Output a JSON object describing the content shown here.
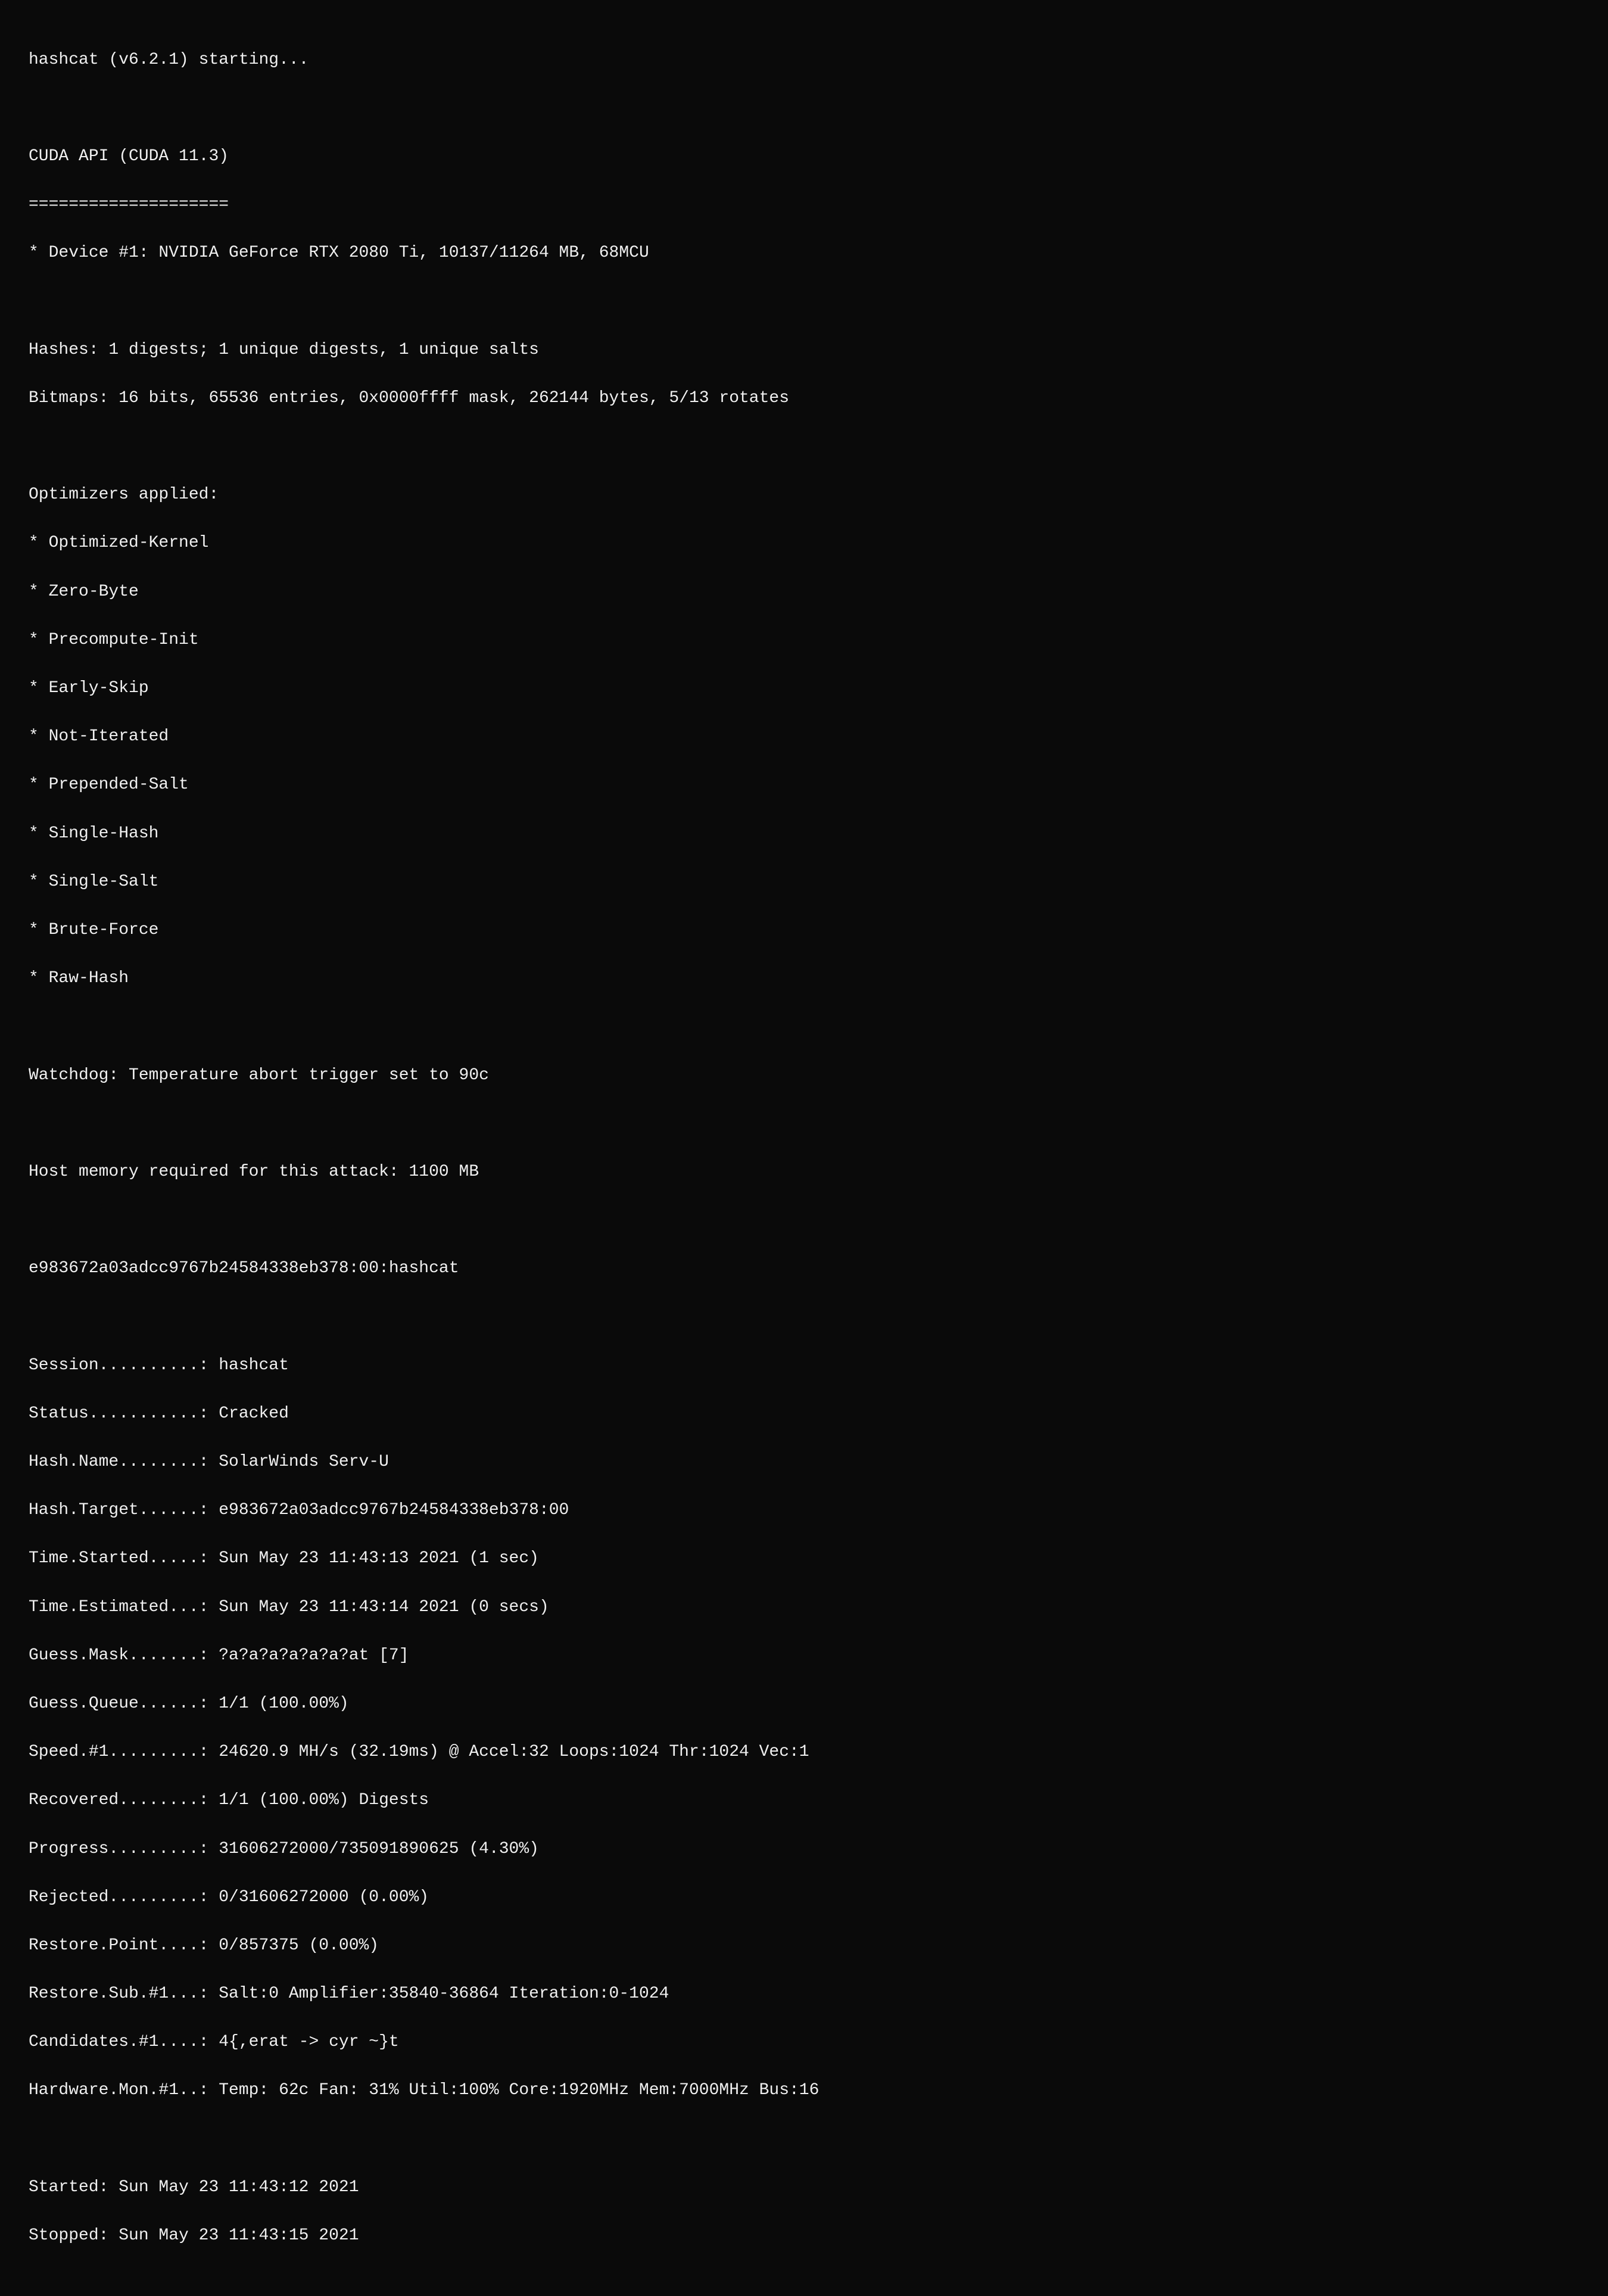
{
  "terminal": {
    "lines": [
      {
        "id": "line-1",
        "text": "hashcat (v6.2.1) starting..."
      },
      {
        "id": "blank-1",
        "text": ""
      },
      {
        "id": "line-2",
        "text": "CUDA API (CUDA 11.3)"
      },
      {
        "id": "line-3",
        "text": "===================="
      },
      {
        "id": "line-4",
        "text": "* Device #1: NVIDIA GeForce RTX 2080 Ti, 10137/11264 MB, 68MCU"
      },
      {
        "id": "blank-2",
        "text": ""
      },
      {
        "id": "line-5",
        "text": "Hashes: 1 digests; 1 unique digests, 1 unique salts"
      },
      {
        "id": "line-6",
        "text": "Bitmaps: 16 bits, 65536 entries, 0x0000ffff mask, 262144 bytes, 5/13 rotates"
      },
      {
        "id": "blank-3",
        "text": ""
      },
      {
        "id": "line-7",
        "text": "Optimizers applied:"
      },
      {
        "id": "line-8",
        "text": "* Optimized-Kernel"
      },
      {
        "id": "line-9",
        "text": "* Zero-Byte"
      },
      {
        "id": "line-10",
        "text": "* Precompute-Init"
      },
      {
        "id": "line-11",
        "text": "* Early-Skip"
      },
      {
        "id": "line-12",
        "text": "* Not-Iterated"
      },
      {
        "id": "line-13",
        "text": "* Prepended-Salt"
      },
      {
        "id": "line-14",
        "text": "* Single-Hash"
      },
      {
        "id": "line-15",
        "text": "* Single-Salt"
      },
      {
        "id": "line-16",
        "text": "* Brute-Force"
      },
      {
        "id": "line-17",
        "text": "* Raw-Hash"
      },
      {
        "id": "blank-4",
        "text": ""
      },
      {
        "id": "line-18",
        "text": "Watchdog: Temperature abort trigger set to 90c"
      },
      {
        "id": "blank-5",
        "text": ""
      },
      {
        "id": "line-19",
        "text": "Host memory required for this attack: 1100 MB"
      },
      {
        "id": "blank-6",
        "text": ""
      },
      {
        "id": "line-20",
        "text": "e983672a03adcc9767b24584338eb378:00:hashcat"
      },
      {
        "id": "blank-7",
        "text": ""
      },
      {
        "id": "line-21",
        "text": "Session..........: hashcat"
      },
      {
        "id": "line-22",
        "text": "Status...........: Cracked"
      },
      {
        "id": "line-23",
        "text": "Hash.Name........: SolarWinds Serv-U"
      },
      {
        "id": "line-24",
        "text": "Hash.Target......: e983672a03adcc9767b24584338eb378:00"
      },
      {
        "id": "line-25",
        "text": "Time.Started.....: Sun May 23 11:43:13 2021 (1 sec)"
      },
      {
        "id": "line-26",
        "text": "Time.Estimated...: Sun May 23 11:43:14 2021 (0 secs)"
      },
      {
        "id": "line-27",
        "text": "Guess.Mask.......: ?a?a?a?a?a?a?at [7]"
      },
      {
        "id": "line-28",
        "text": "Guess.Queue......: 1/1 (100.00%)"
      },
      {
        "id": "line-29",
        "text": "Speed.#1.........: 24620.9 MH/s (32.19ms) @ Accel:32 Loops:1024 Thr:1024 Vec:1"
      },
      {
        "id": "line-30",
        "text": "Recovered........: 1/1 (100.00%) Digests"
      },
      {
        "id": "line-31",
        "text": "Progress.........: 31606272000/735091890625 (4.30%)"
      },
      {
        "id": "line-32",
        "text": "Rejected.........: 0/31606272000 (0.00%)"
      },
      {
        "id": "line-33",
        "text": "Restore.Point....: 0/857375 (0.00%)"
      },
      {
        "id": "line-34",
        "text": "Restore.Sub.#1...: Salt:0 Amplifier:35840-36864 Iteration:0-1024"
      },
      {
        "id": "line-35",
        "text": "Candidates.#1....: 4{,erat -> cyr ~}t"
      },
      {
        "id": "line-36",
        "text": "Hardware.Mon.#1..: Temp: 62c Fan: 31% Util:100% Core:1920MHz Mem:7000MHz Bus:16"
      },
      {
        "id": "blank-8",
        "text": ""
      },
      {
        "id": "line-37",
        "text": "Started: Sun May 23 11:43:12 2021"
      },
      {
        "id": "line-38",
        "text": "Stopped: Sun May 23 11:43:15 2021"
      }
    ]
  }
}
